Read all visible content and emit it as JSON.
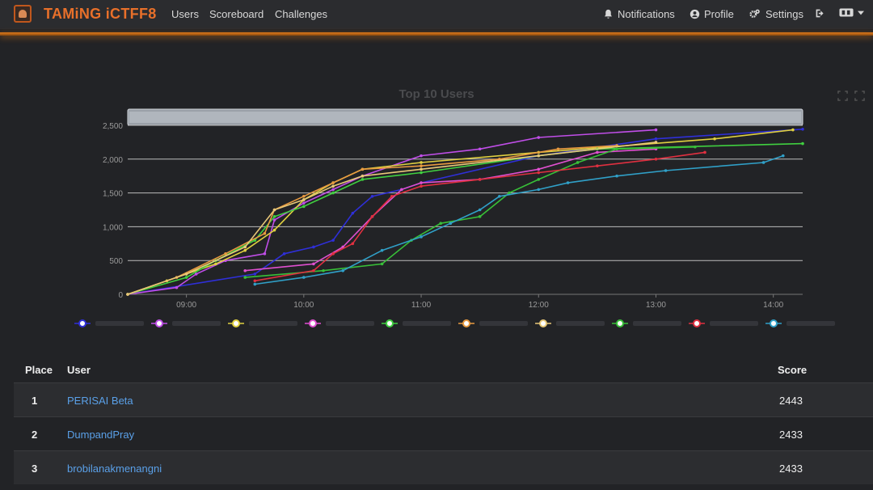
{
  "app": {
    "title": "TAMiNG iCTFF8"
  },
  "nav": {
    "links": [
      "Users",
      "Scoreboard",
      "Challenges"
    ],
    "notifications": "Notifications",
    "profile": "Profile",
    "settings": "Settings"
  },
  "colors": {
    "accent": "#e8702a",
    "link": "#5aa0e8",
    "background": "#222326"
  },
  "chart_data": {
    "type": "line",
    "title": "Top 10 Users",
    "xlabel": "",
    "ylabel": "",
    "x_ticks": [
      "09:00",
      "10:00",
      "11:00",
      "12:00",
      "13:00",
      "14:00"
    ],
    "y_ticks": [
      "0",
      "500",
      "1,000",
      "1,500",
      "2,000",
      "2,500"
    ],
    "xlim": [
      "08:30",
      "14:15"
    ],
    "ylim": [
      0,
      2500
    ],
    "grid": true,
    "legend": "bottom",
    "series": [
      {
        "color": "#2f2fd8",
        "points": [
          [
            "08:30",
            0
          ],
          [
            "09:35",
            300
          ],
          [
            "09:50",
            600
          ],
          [
            "10:05",
            700
          ],
          [
            "10:15",
            800
          ],
          [
            "10:25",
            1200
          ],
          [
            "10:35",
            1450
          ],
          [
            "10:50",
            1550
          ],
          [
            "11:00",
            1650
          ],
          [
            "12:00",
            2050
          ],
          [
            "13:00",
            2300
          ],
          [
            "14:15",
            2443
          ]
        ]
      },
      {
        "color": "#c04ee8",
        "points": [
          [
            "08:30",
            0
          ],
          [
            "08:55",
            100
          ],
          [
            "09:05",
            300
          ],
          [
            "09:20",
            500
          ],
          [
            "09:40",
            600
          ],
          [
            "09:45",
            1100
          ],
          [
            "10:00",
            1350
          ],
          [
            "10:15",
            1550
          ],
          [
            "10:30",
            1750
          ],
          [
            "11:00",
            2050
          ],
          [
            "11:30",
            2150
          ],
          [
            "12:00",
            2320
          ],
          [
            "13:00",
            2433
          ]
        ]
      },
      {
        "color": "#e0d040",
        "points": [
          [
            "08:30",
            0
          ],
          [
            "08:50",
            200
          ],
          [
            "09:00",
            300
          ],
          [
            "09:15",
            450
          ],
          [
            "09:30",
            650
          ],
          [
            "09:45",
            950
          ],
          [
            "10:00",
            1400
          ],
          [
            "10:15",
            1650
          ],
          [
            "10:30",
            1850
          ],
          [
            "11:00",
            1950
          ],
          [
            "12:00",
            2100
          ],
          [
            "13:30",
            2300
          ],
          [
            "14:10",
            2433
          ]
        ]
      },
      {
        "color": "#e050d0",
        "points": [
          [
            "09:30",
            350
          ],
          [
            "10:05",
            450
          ],
          [
            "10:20",
            700
          ],
          [
            "10:35",
            1150
          ],
          [
            "10:50",
            1550
          ],
          [
            "11:00",
            1650
          ],
          [
            "11:30",
            1700
          ],
          [
            "12:00",
            1850
          ],
          [
            "12:30",
            2100
          ],
          [
            "13:00",
            2150
          ]
        ]
      },
      {
        "color": "#40d040",
        "points": [
          [
            "08:30",
            0
          ],
          [
            "09:00",
            250
          ],
          [
            "09:15",
            500
          ],
          [
            "09:35",
            800
          ],
          [
            "09:45",
            1150
          ],
          [
            "10:00",
            1300
          ],
          [
            "10:15",
            1500
          ],
          [
            "10:30",
            1700
          ],
          [
            "11:00",
            1800
          ],
          [
            "12:00",
            2050
          ],
          [
            "12:30",
            2150
          ],
          [
            "14:15",
            2230
          ]
        ]
      },
      {
        "color": "#e89a40",
        "points": [
          [
            "08:30",
            0
          ],
          [
            "08:55",
            250
          ],
          [
            "09:20",
            600
          ],
          [
            "09:40",
            900
          ],
          [
            "09:45",
            1250
          ],
          [
            "10:00",
            1450
          ],
          [
            "10:15",
            1650
          ],
          [
            "10:30",
            1850
          ],
          [
            "11:00",
            1900
          ],
          [
            "11:40",
            2000
          ],
          [
            "12:10",
            2150
          ],
          [
            "12:40",
            2200
          ]
        ]
      },
      {
        "color": "#e8c878",
        "points": [
          [
            "08:30",
            0
          ],
          [
            "09:00",
            300
          ],
          [
            "09:30",
            700
          ],
          [
            "09:45",
            1250
          ],
          [
            "10:00",
            1400
          ],
          [
            "10:15",
            1600
          ],
          [
            "10:30",
            1750
          ],
          [
            "11:00",
            1850
          ],
          [
            "12:00",
            2050
          ],
          [
            "13:00",
            2250
          ]
        ]
      },
      {
        "color": "#38c038",
        "points": [
          [
            "09:30",
            250
          ],
          [
            "10:10",
            350
          ],
          [
            "10:40",
            450
          ],
          [
            "10:55",
            800
          ],
          [
            "11:10",
            1050
          ],
          [
            "11:30",
            1150
          ],
          [
            "11:45",
            1500
          ],
          [
            "12:00",
            1700
          ],
          [
            "12:20",
            1950
          ],
          [
            "12:40",
            2150
          ],
          [
            "13:20",
            2180
          ]
        ]
      },
      {
        "color": "#e03040",
        "points": [
          [
            "09:35",
            200
          ],
          [
            "10:05",
            350
          ],
          [
            "10:15",
            600
          ],
          [
            "10:25",
            750
          ],
          [
            "10:35",
            1150
          ],
          [
            "10:45",
            1450
          ],
          [
            "11:00",
            1600
          ],
          [
            "11:30",
            1700
          ],
          [
            "12:00",
            1800
          ],
          [
            "12:30",
            1900
          ],
          [
            "13:00",
            2000
          ],
          [
            "13:25",
            2100
          ]
        ]
      },
      {
        "color": "#30a0c8",
        "points": [
          [
            "09:35",
            150
          ],
          [
            "10:00",
            250
          ],
          [
            "10:20",
            350
          ],
          [
            "10:40",
            650
          ],
          [
            "11:00",
            850
          ],
          [
            "11:15",
            1050
          ],
          [
            "11:30",
            1250
          ],
          [
            "11:40",
            1450
          ],
          [
            "12:00",
            1550
          ],
          [
            "12:15",
            1650
          ],
          [
            "12:40",
            1750
          ],
          [
            "13:05",
            1830
          ],
          [
            "13:55",
            1950
          ],
          [
            "14:05",
            2050
          ]
        ]
      }
    ]
  },
  "table": {
    "headers": {
      "place": "Place",
      "user": "User",
      "score": "Score"
    },
    "rows": [
      {
        "place": "1",
        "user": "PERISAI Beta",
        "score": "2443"
      },
      {
        "place": "2",
        "user": "DumpandPray",
        "score": "2433"
      },
      {
        "place": "3",
        "user": "brobilanakmenangni",
        "score": "2433"
      }
    ]
  }
}
